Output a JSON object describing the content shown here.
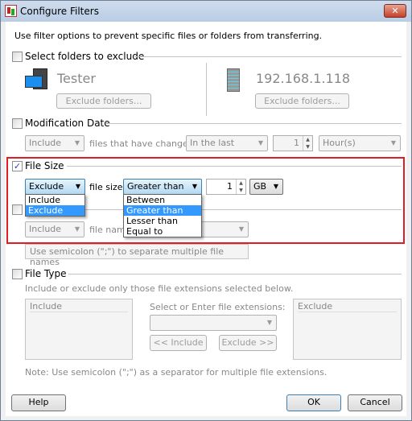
{
  "window": {
    "title": "Configure Filters",
    "close_label": "✕"
  },
  "intro": "Use filter options to prevent specific files or folders from transferring.",
  "folders": {
    "label": "Select folders to exclude",
    "checked": false,
    "local": {
      "name": "Tester",
      "button": "Exclude folders...",
      "icon": "computer-icon"
    },
    "remote": {
      "name": "192.168.1.118",
      "button": "Exclude folders...",
      "icon": "server-icon"
    }
  },
  "mod_date": {
    "label": "Modification Date",
    "checked": false,
    "mode": "Include",
    "text": "files that have changed",
    "range": "In the last",
    "value": "1",
    "unit": "Hour(s)"
  },
  "file_size": {
    "label": "File Size",
    "checked": true,
    "mode": "Exclude",
    "text": "file size",
    "comparison": "Greater than",
    "value": "1",
    "unit": "GB",
    "mode_options": [
      "Include",
      "Exclude"
    ],
    "comparison_options": [
      "Between",
      "Greater than",
      "Lesser than",
      "Equal to"
    ]
  },
  "file_name": {
    "checked": false,
    "mode": "Include",
    "text": "file name",
    "hint": "Use semicolon (\";\") to separate multiple file names"
  },
  "file_type": {
    "label": "File Type",
    "checked": false,
    "desc": "Include or exclude only those file extensions selected below.",
    "include_header": "Include",
    "exclude_header": "Exclude",
    "ext_label": "Select or Enter file extensions:",
    "include_button": "<< Include",
    "exclude_button": "Exclude >>",
    "note": "Note: Use semicolon (\";\") as a separator for multiple file extensions."
  },
  "footer": {
    "help": "Help",
    "ok": "OK",
    "cancel": "Cancel"
  },
  "colors": {
    "highlight": "#3399ff",
    "annotation_box": "#e31b23"
  }
}
